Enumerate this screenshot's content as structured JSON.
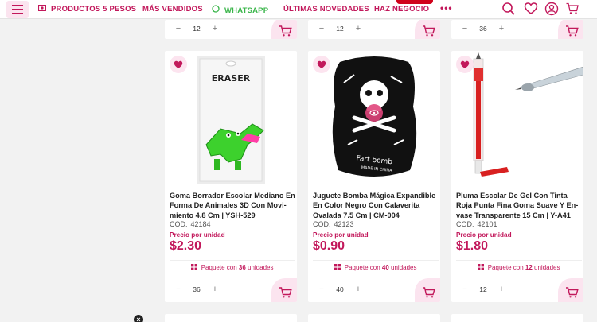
{
  "nav": {
    "items": [
      {
        "label": "PRODUCTOS 5 PESOS",
        "icon": "cash-icon"
      },
      {
        "label": "MÁS VENDIDOS"
      },
      {
        "label": "WHATSAPP",
        "icon": "whatsapp-icon"
      },
      {
        "label": "ÚLTIMAS NOVEDADES"
      },
      {
        "label": "HAZ NEGOCIO"
      }
    ],
    "more": "•••",
    "brand_color": "#c2185b",
    "whatsapp_color": "#3ab54a"
  },
  "top_row": {
    "quantities": [
      "12",
      "12",
      "36"
    ]
  },
  "products": [
    {
      "title": "Goma Borrador Escolar Mediano En Forma De Animales 3D Con Movi-miento 4.8 Cm | YSH-529",
      "cod_label": "COD:",
      "cod": "42184",
      "price_label": "Precio por unidad",
      "price": "$2.30",
      "pack_prefix": "Paquete con",
      "pack_count": "36",
      "pack_suffix": "unidades",
      "quantity": "36",
      "image_text": "ERASER"
    },
    {
      "title": "Juguete Bomba Mágica Expandible En Color Negro Con Calaverita Ovalada 7.5 Cm | CM-004",
      "cod_label": "COD:",
      "cod": "42123",
      "price_label": "Precio por unidad",
      "price": "$0.90",
      "pack_prefix": "Paquete con",
      "pack_count": "40",
      "pack_suffix": "unidades",
      "quantity": "40",
      "image_text": "Fart bomb",
      "image_subtext": "MADE IN CHINA"
    },
    {
      "title": "Pluma Escolar De Gel Con Tinta Roja Punta Fina Goma Suave Y En-vase Transparente 15 Cm | Y-A41",
      "cod_label": "COD:",
      "cod": "42101",
      "price_label": "Precio por unidad",
      "price": "$1.80",
      "pack_prefix": "Paquete con",
      "pack_count": "12",
      "pack_suffix": "unidades",
      "quantity": "12"
    }
  ],
  "stepper": {
    "minus": "−",
    "plus": "+"
  },
  "close_badge": "×"
}
